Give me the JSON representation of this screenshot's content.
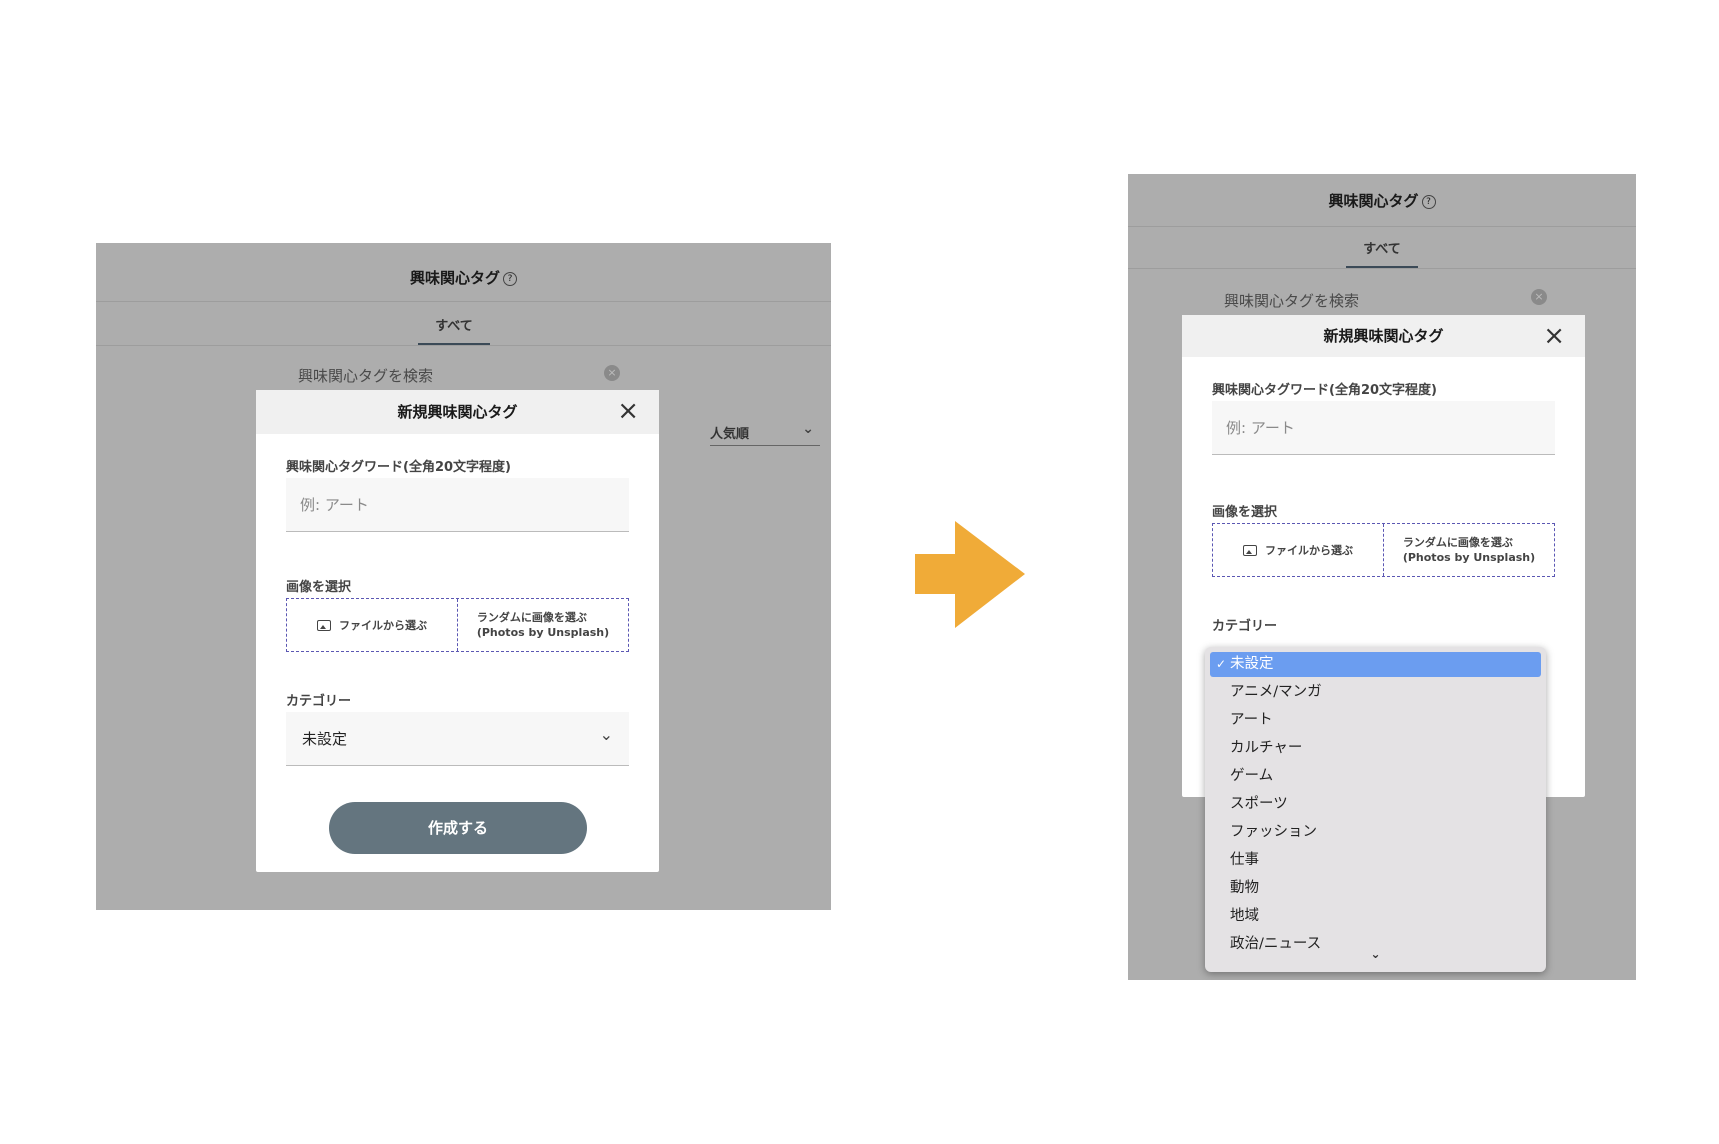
{
  "left": {
    "header": {
      "title": "興味関心タグ",
      "help_icon": "?"
    },
    "tab": {
      "label": "すべて"
    },
    "search": {
      "placeholder": "興味関心タグを検索",
      "clear_icon": "×"
    },
    "sort": {
      "label": "人気順",
      "chevron": "⌄"
    },
    "modal": {
      "title": "新規興味関心タグ",
      "close_icon": "×",
      "word_label": "興味関心タグワード(全角20文字程度)",
      "word_placeholder": "例: アート",
      "image_label": "画像を選択",
      "file_button": "ファイルから選ぶ",
      "random_button_line1": "ランダムに画像を選ぶ",
      "random_button_line2": "(Photos by Unsplash)",
      "category_label": "カテゴリー",
      "category_value": "未設定",
      "category_chevron": "⌄",
      "submit": "作成する"
    }
  },
  "right": {
    "header": {
      "title": "興味関心タグ",
      "help_icon": "?"
    },
    "tab": {
      "label": "すべて"
    },
    "search": {
      "placeholder": "興味関心タグを検索",
      "clear_icon": "×"
    },
    "modal": {
      "title": "新規興味関心タグ",
      "close_icon": "×",
      "word_label": "興味関心タグワード(全角20文字程度)",
      "word_placeholder": "例: アート",
      "image_label": "画像を選択",
      "file_button": "ファイルから選ぶ",
      "random_button_line1": "ランダムに画像を選ぶ",
      "random_button_line2": "(Photos by Unsplash)",
      "category_label": "カテゴリー"
    },
    "dropdown": {
      "check": "✓",
      "options": [
        "未設定",
        "アニメ/マンガ",
        "アート",
        "カルチャー",
        "ゲーム",
        "スポーツ",
        "ファッション",
        "仕事",
        "動物",
        "地域",
        "政治/ニュース"
      ],
      "selected_index": 0,
      "more_icon": "⌄"
    }
  },
  "colors": {
    "arrow": "#f0ab38",
    "overlay": "#adadad",
    "button": "#64757f",
    "selection": "#6b9df0",
    "dashed_border": "#5b57b3"
  }
}
